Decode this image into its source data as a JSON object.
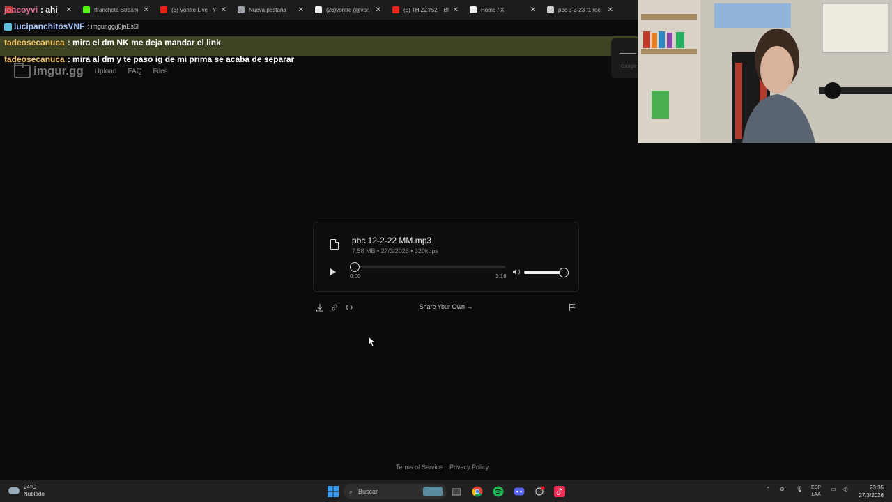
{
  "browser": {
    "tabs": [
      {
        "title": "",
        "color": "#c0392b"
      },
      {
        "title": "ffranchota Stream",
        "color": "#53fc18"
      },
      {
        "title": "(6) Vonfre Live - Y",
        "color": "#e62117"
      },
      {
        "title": "Nueva pestaña",
        "color": "#9aa0a6"
      },
      {
        "title": "(26)vonfre (@von",
        "color": "#eeeeee"
      },
      {
        "title": "(5) THIZZY52 – Bl",
        "color": "#e62117"
      },
      {
        "title": "Home / X",
        "color": "#eeeeee"
      },
      {
        "title": "pbc 3-3-23 f1 roc",
        "color": "#cccccc"
      }
    ]
  },
  "chat": [
    {
      "user": "joacoyvi",
      "message": ": ahi",
      "user_color": "#e8719a"
    },
    {
      "user": "lucipanchitosVNF",
      "message": ": imgur.gg/j0jaEs6l",
      "user_color": "#a9c4ff"
    },
    {
      "user": "tadeosecanuca",
      "message": ": mira el dm NK me deja mandar el link",
      "user_color": "#f0c060"
    },
    {
      "user": "tadeosecanuca",
      "message": ": mira al dm y te paso ig de mi prima se acaba de separar",
      "user_color": "#f0c060"
    }
  ],
  "site": {
    "logo": "imgur.gg",
    "nav": [
      "Upload",
      "FAQ",
      "Files"
    ]
  },
  "player": {
    "file_name": "pbc 12-2-22 MM.mp3",
    "file_meta": "7.58 MB • 27/3/2026 • 320kbps",
    "current_time": "0:00",
    "total_time": "3:18",
    "progress": 0,
    "volume_percent": 100
  },
  "actions": {
    "share_label": "Share Your Own →"
  },
  "footer": {
    "terms": "Terms of Service",
    "privacy": "Privacy Policy"
  },
  "google_widget": "Google",
  "taskbar": {
    "weather_temp": "24°C",
    "weather_desc": "Nublado",
    "search_placeholder": "Buscar",
    "lang": "ESP",
    "lang_sub": "LAA",
    "time": "23:35",
    "date": "27/3/2026"
  },
  "colors": {
    "background": "#0b0b0b",
    "accent": "#eeeeee"
  }
}
